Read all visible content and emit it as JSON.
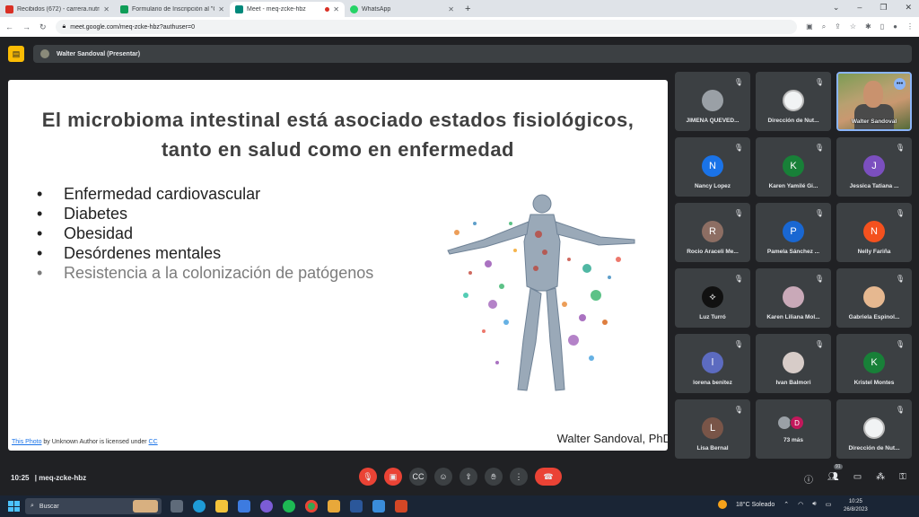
{
  "browser": {
    "tabs": [
      {
        "title": "Recibidos (672) - carrera.nutricio",
        "color": "#d93025",
        "active": false
      },
      {
        "title": "Formulario de Inscripción al \"Cu",
        "color": "#0f9d58",
        "active": false
      },
      {
        "title": "Meet - meq-zcke-hbz",
        "color": "#00897b",
        "active": true
      },
      {
        "title": "WhatsApp",
        "color": "#25d366",
        "active": false
      }
    ],
    "new_tab": "+",
    "url": "meet.google.com/meq-zcke-hbz?authuser=0"
  },
  "meet": {
    "presenter_label": "Walter Sandoval (Presentar)",
    "slide": {
      "title": "El microbioma intestinal está asociado estados fisiológicos, tanto en salud como en enfermedad",
      "bullets": [
        "Enfermedad cardiovascular",
        "Diabetes",
        "Obesidad",
        "Desórdenes mentales",
        "Resistencia a la colonización de patógenos"
      ],
      "credit_link": "This Photo",
      "credit_text": " by Unknown Author is licensed under ",
      "credit_license": "CC",
      "author": "Walter Sandoval, PhD"
    },
    "participants": [
      {
        "name": "JIMENA QUEVED...",
        "initial": "",
        "color": "#9aa0a6"
      },
      {
        "name": "Dirección de Nut...",
        "initial": "",
        "color": "#f1f3f4"
      },
      {
        "name": "Walter Sandoval",
        "initial": "",
        "color": "#6a7b5a"
      },
      {
        "name": "Nancy Lopez",
        "initial": "N",
        "color": "#1a73e8"
      },
      {
        "name": "Karen Yamilé Gi...",
        "initial": "K",
        "color": "#188038"
      },
      {
        "name": "Jessica Tatiana ...",
        "initial": "J",
        "color": "#7b4fbf"
      },
      {
        "name": "Rocio Araceli Me...",
        "initial": "R",
        "color": "#8d6e63"
      },
      {
        "name": "Pamela Sánchez ...",
        "initial": "P",
        "color": "#1967d2"
      },
      {
        "name": "Nelly Fariña",
        "initial": "N",
        "color": "#f4511e"
      },
      {
        "name": "Luz Turró",
        "initial": "⟡",
        "color": "#111111"
      },
      {
        "name": "Karen Liliana Mol...",
        "initial": "",
        "color": "#c9a9b8"
      },
      {
        "name": "Gabriela Espinol...",
        "initial": "",
        "color": "#e6b890"
      },
      {
        "name": "lorena benitez",
        "initial": "l",
        "color": "#5c6bc0"
      },
      {
        "name": "Ivan Balmori",
        "initial": "",
        "color": "#d7ccc8"
      },
      {
        "name": "Kristel Montes",
        "initial": "K",
        "color": "#188038"
      },
      {
        "name": "Lisa Bernal",
        "initial": "L",
        "color": "#795548"
      },
      {
        "name": "73 más",
        "initial": "D",
        "color": "#c2185b"
      },
      {
        "name": "Dirección de Nut...",
        "initial": "",
        "color": "#f1f3f4"
      }
    ],
    "time": "10:25",
    "meeting_code": "meq-zcke-hbz",
    "participant_count": "91"
  },
  "taskbar": {
    "search_placeholder": "Buscar",
    "weather": "18°C Soleado",
    "time": "10:25",
    "date": "26/8/2023"
  }
}
